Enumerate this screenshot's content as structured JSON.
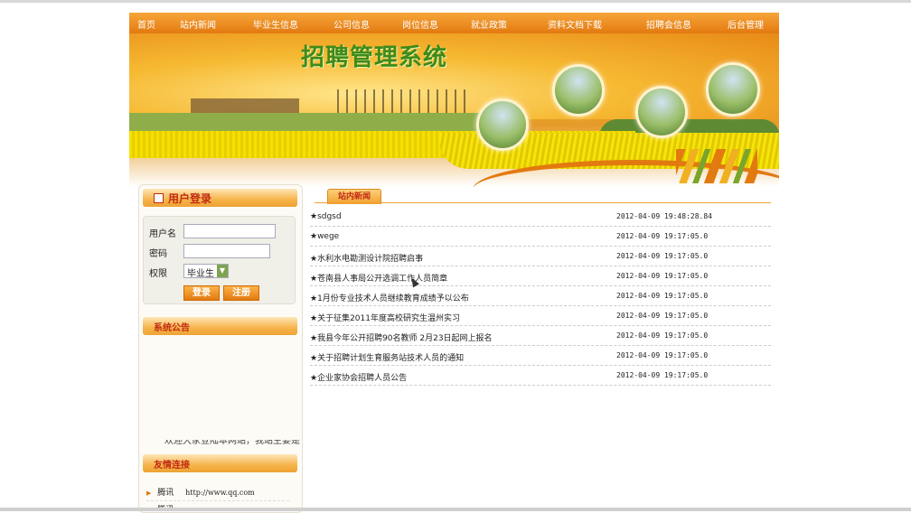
{
  "nav": [
    "首页",
    "站内新闻",
    "毕业生信息",
    "公司信息",
    "岗位信息",
    "就业政策",
    "资料文档下载",
    "招聘会信息",
    "后台管理"
  ],
  "banner": {
    "title": "招聘管理系统"
  },
  "login": {
    "title": "用户登录",
    "username_label": "用户名",
    "password_label": "密码",
    "role_label": "权限",
    "role_value": "毕业生",
    "login_btn": "登录",
    "register_btn": "注册"
  },
  "notice": {
    "title": "系统公告",
    "scroll_text": "欢迎大家登陆本网站，我站主要是"
  },
  "links": {
    "title": "友情连接",
    "items": [
      {
        "name": "腾讯",
        "url": "http://www.qq.com"
      },
      {
        "name": "腾讯",
        "url": ""
      }
    ]
  },
  "news": {
    "tab": "站内新闻",
    "items": [
      {
        "title": "★sdgsd",
        "date": "2012-04-09 19:48:28.84"
      },
      {
        "title": "★wege",
        "date": "2012-04-09 19:17:05.0"
      },
      {
        "title": "★水利水电勘测设计院招聘启事",
        "date": "2012-04-09 19:17:05.0"
      },
      {
        "title": "★苍南县人事局公开选调工作人员简章",
        "date": "2012-04-09 19:17:05.0"
      },
      {
        "title": "★1月份专业技术人员继续教育成绩予以公布",
        "date": "2012-04-09 19:17:05.0"
      },
      {
        "title": "★关于征集2011年度高校研究生温州实习",
        "date": "2012-04-09 19:17:05.0"
      },
      {
        "title": "★我县今年公开招聘90名教师 2月23日起网上报名",
        "date": "2012-04-09 19:17:05.0"
      },
      {
        "title": "★关于招聘计划生育服务站技术人员的通知",
        "date": "2012-04-09 19:17:05.0"
      },
      {
        "title": "★企业家协会招聘人员公告",
        "date": "2012-04-09 19:17:05.0"
      }
    ]
  }
}
